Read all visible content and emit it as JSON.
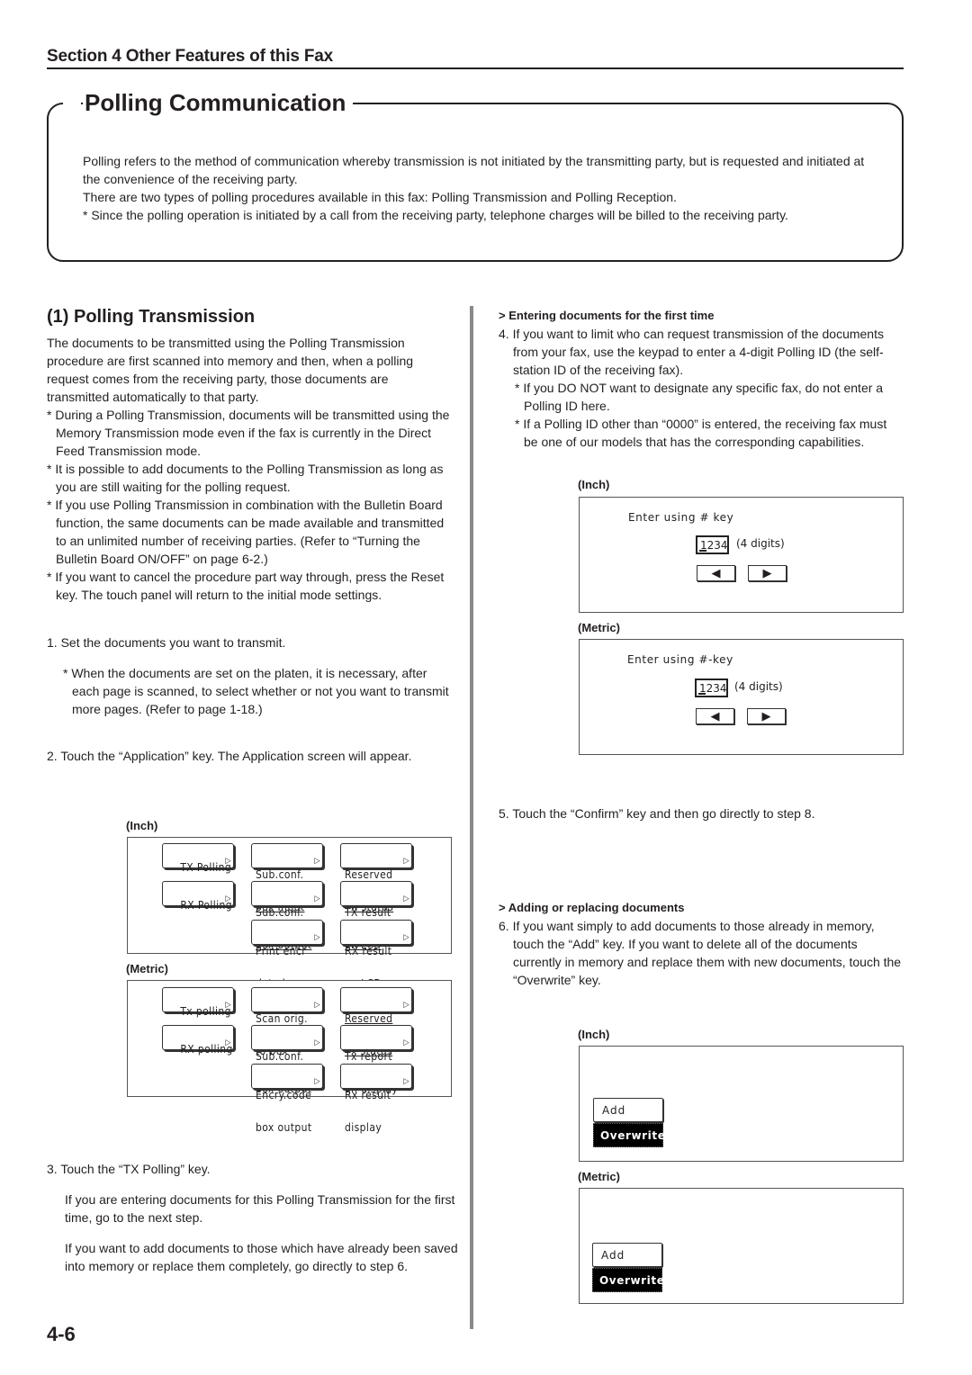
{
  "header": {
    "section_title": "Section 4 Other Features of this Fax"
  },
  "polling_communication": {
    "title": "Polling Communication",
    "paragraphs": [
      "Polling refers to the method of communication whereby transmission is not initiated by the transmitting party, but is requested and initiated at the convenience of the receiving party.",
      "There are two types of polling procedures available in this fax: Polling Transmission and Polling Reception.",
      "* Since the polling operation is initiated by a call from the receiving party, telephone charges will be billed to the receiving party."
    ]
  },
  "polling_transmission": {
    "heading": "(1) Polling Transmission",
    "intro": "The documents to be transmitted using the Polling Transmission procedure are first scanned into memory and then, when a polling request comes from the receiving party, those documents are transmitted automatically to that party.",
    "notes": [
      "* During a Polling Transmission, documents will be transmitted using the Memory Transmission mode even if the fax is currently in the Direct Feed Transmission mode.",
      "* It is possible to add documents to the Polling Transmission as long as you are still waiting for the polling request.",
      "* If you use Polling Transmission in combination with the Bulletin Board function, the same documents can be made available and transmitted to an unlimited number of receiving parties. (Refer to “Turning the Bulletin Board ON/OFF” on page 6-2.)",
      "* If you want to cancel the procedure part way through, press the Reset key. The touch panel will return to the initial mode settings."
    ],
    "step1": {
      "text": "1. Set the documents you want to transmit.",
      "note": "* When the documents are set on the platen, it is necessary, after each page is scanned, to select whether or not you want to transmit more pages. (Refer to page 1-18.)"
    },
    "step2": {
      "text": "2. Touch the “Application” key. The Application screen will appear."
    },
    "step3": {
      "text": "3. Touch the “TX Polling” key.",
      "lines": [
        "If you are entering documents for this Polling Transmission for the first time, go to the next step.",
        "If you want to add documents to those which have already been saved into memory or replace them completely, go directly to step 6."
      ]
    }
  },
  "application_screens": {
    "inch": {
      "label": "(Inch)",
      "buttons": [
        {
          "line1": "TX Polling",
          "line2": ""
        },
        {
          "line1": "Sub.conf.",
          "line2": "box Input"
        },
        {
          "line1": "Reserved",
          "line2": "TX status"
        },
        {
          "line1": "RX Polling",
          "line2": ""
        },
        {
          "line1": "Sub.conf.",
          "line2": "box output"
        },
        {
          "line1": "TX result",
          "line2": "on LCD"
        },
        {
          "line1": "Print encr",
          "line2": "data box"
        },
        {
          "line1": "RX result",
          "line2": "on LCD"
        }
      ]
    },
    "metric": {
      "label": "(Metric)",
      "buttons": [
        {
          "line1": "Tx polling",
          "line2": ""
        },
        {
          "line1": "Scan orig.",
          "line2": "to box"
        },
        {
          "line1": "Reserved",
          "line2": "Tx status"
        },
        {
          "line1": "RX polling",
          "line2": ""
        },
        {
          "line1": "Sub.conf.",
          "line2": "box output"
        },
        {
          "line1": "Tx report",
          "line2": "on display"
        },
        {
          "line1": "Encry.code",
          "line2": "box output"
        },
        {
          "line1": "Rx result",
          "line2": "display"
        }
      ]
    },
    "arrow_glyph": "▷"
  },
  "right_column": {
    "subhead_first": "> Entering documents for the first time",
    "step4": {
      "text": "4. If you want to limit who can request transmission of the documents from your fax, use the keypad to enter a 4-digit Polling ID (the self-station ID of the receiving fax).",
      "notes": [
        "* If you DO NOT want to designate any specific fax, do not enter a Polling ID here.",
        "* If a Polling ID other than “0000” is entered, the receiving fax must be one of our models that has the corresponding capabilities."
      ]
    },
    "polling_id_screens": {
      "inch": {
        "label": "(Inch)",
        "prompt": "Enter using # key",
        "value": "1234",
        "hint": "(4 digits)",
        "left_arrow": "◀",
        "right_arrow": "▶"
      },
      "metric": {
        "label": "(Metric)",
        "prompt": "Enter using #-key",
        "value": "1234",
        "hint": "(4 digits)",
        "left_arrow": "◀",
        "right_arrow": "▶"
      }
    },
    "step5": "5. Touch the “Confirm” key and then go directly to step 8.",
    "subhead_adding": "> Adding or replacing documents",
    "step6": "6. If you want simply to add documents to those already in memory, touch the “Add” key. If you want to delete all of the documents currently in memory and replace them with new documents, touch the “Overwrite” key.",
    "add_screens": {
      "inch": {
        "label": "(Inch)",
        "add": "Add",
        "overwrite": "Overwrite"
      },
      "metric": {
        "label": "(Metric)",
        "add": "Add",
        "overwrite": "Overwrite"
      }
    }
  },
  "footer": {
    "page_number": "4-6"
  }
}
